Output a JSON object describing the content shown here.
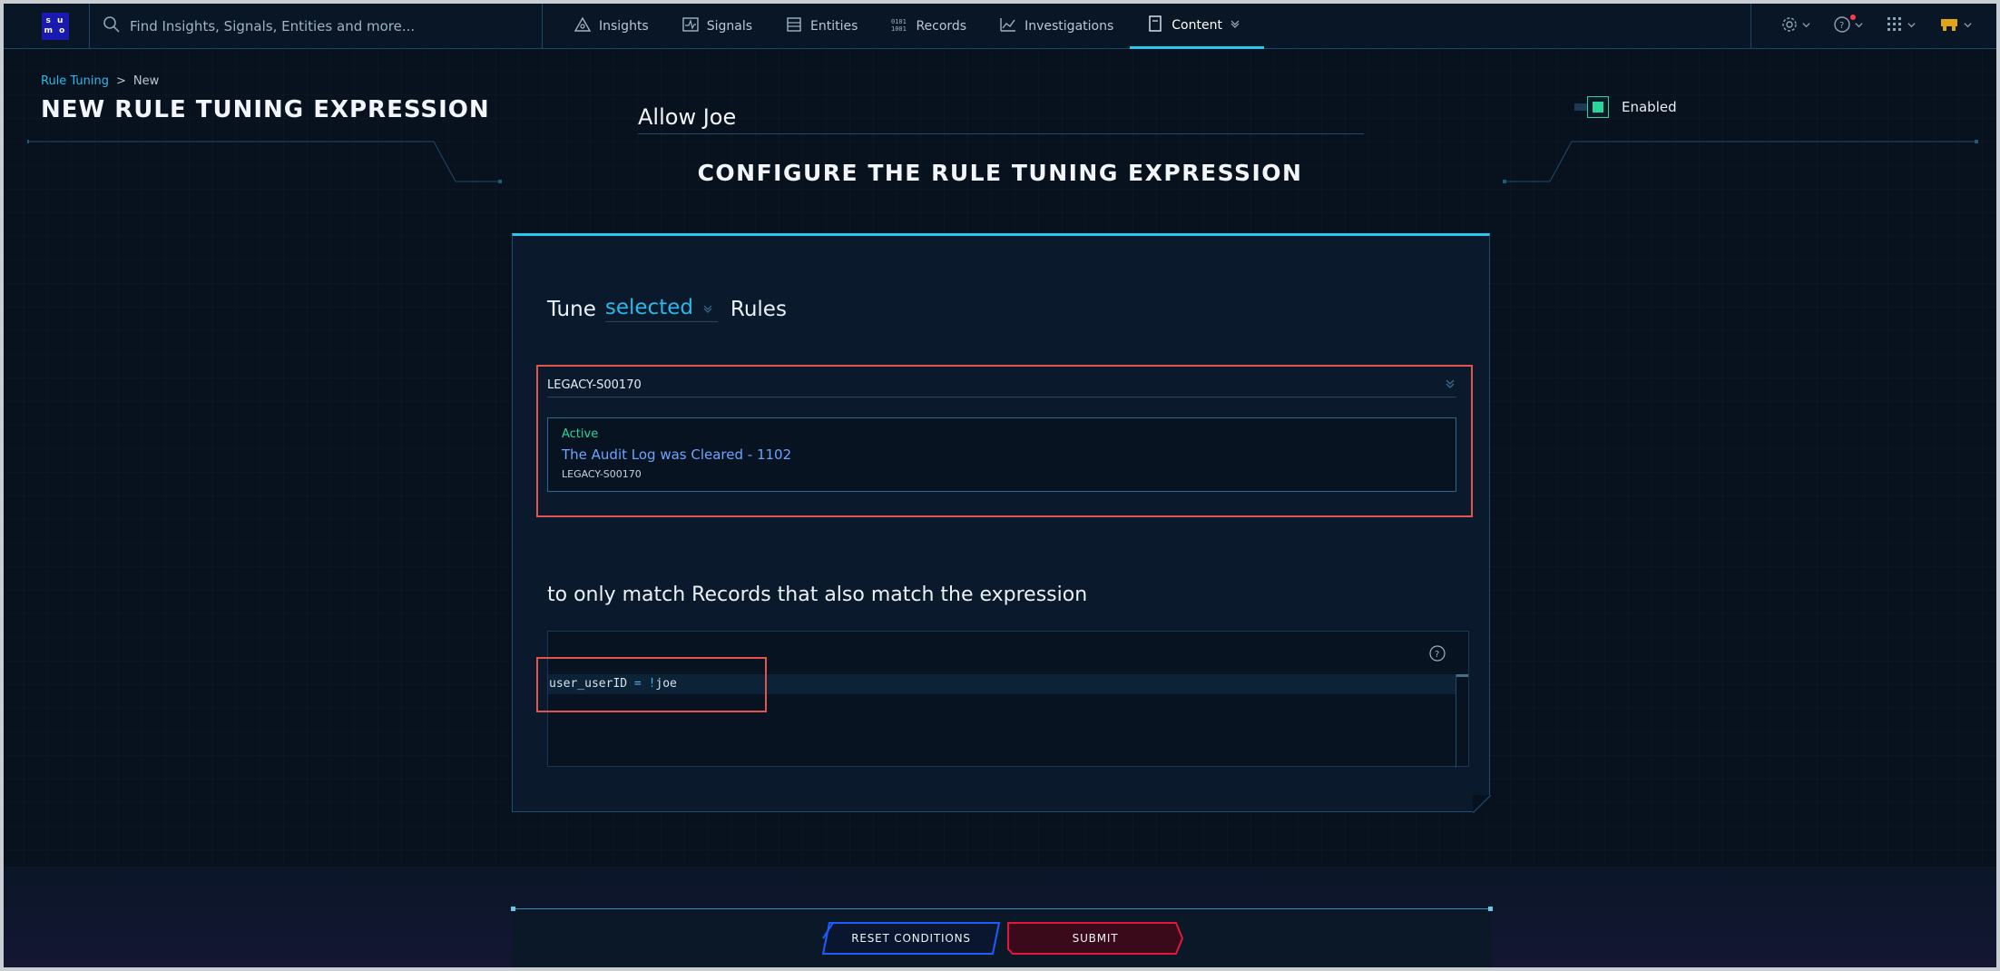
{
  "nav": {
    "logo_line1": "s u",
    "logo_line2": "m o",
    "search_placeholder": "Find Insights, Signals, Entities and more...",
    "items": [
      {
        "label": "Insights",
        "icon": "insights-icon"
      },
      {
        "label": "Signals",
        "icon": "signals-icon"
      },
      {
        "label": "Entities",
        "icon": "entities-icon"
      },
      {
        "label": "Records",
        "icon": "records-icon"
      },
      {
        "label": "Investigations",
        "icon": "investigations-icon"
      },
      {
        "label": "Content",
        "icon": "content-icon",
        "active": true
      }
    ],
    "right_icons": [
      "settings-icon",
      "help-icon",
      "apps-grid-icon",
      "account-icon"
    ]
  },
  "breadcrumb": {
    "parent": "Rule Tuning",
    "separator": ">",
    "current": "New"
  },
  "page_title": "NEW RULE TUNING EXPRESSION",
  "expression_name": "Allow Joe",
  "enabled": {
    "label": "Enabled",
    "checked": true
  },
  "section_title": "CONFIGURE THE RULE TUNING EXPRESSION",
  "tune": {
    "prefix": "Tune",
    "selection": "selected",
    "suffix": "Rules",
    "rule_select_value": "LEGACY-S00170",
    "selected_rule": {
      "status": "Active",
      "name": "The Audit Log was Cleared - 1102",
      "id": "LEGACY-S00170"
    }
  },
  "match_text": "to only match Records that also match the expression",
  "expression": {
    "field": "user_userID",
    "operator": "=",
    "negation": "!",
    "value": "joe"
  },
  "footer": {
    "reset_label": "RESET CONDITIONS",
    "submit_label": "SUBMIT"
  },
  "colors": {
    "accent": "#27c7ef",
    "active_status": "#2bd59a",
    "rule_link": "#6ea4ff",
    "highlight": "#e0564a",
    "submit": "#e0183c",
    "reset": "#1e5cff"
  }
}
